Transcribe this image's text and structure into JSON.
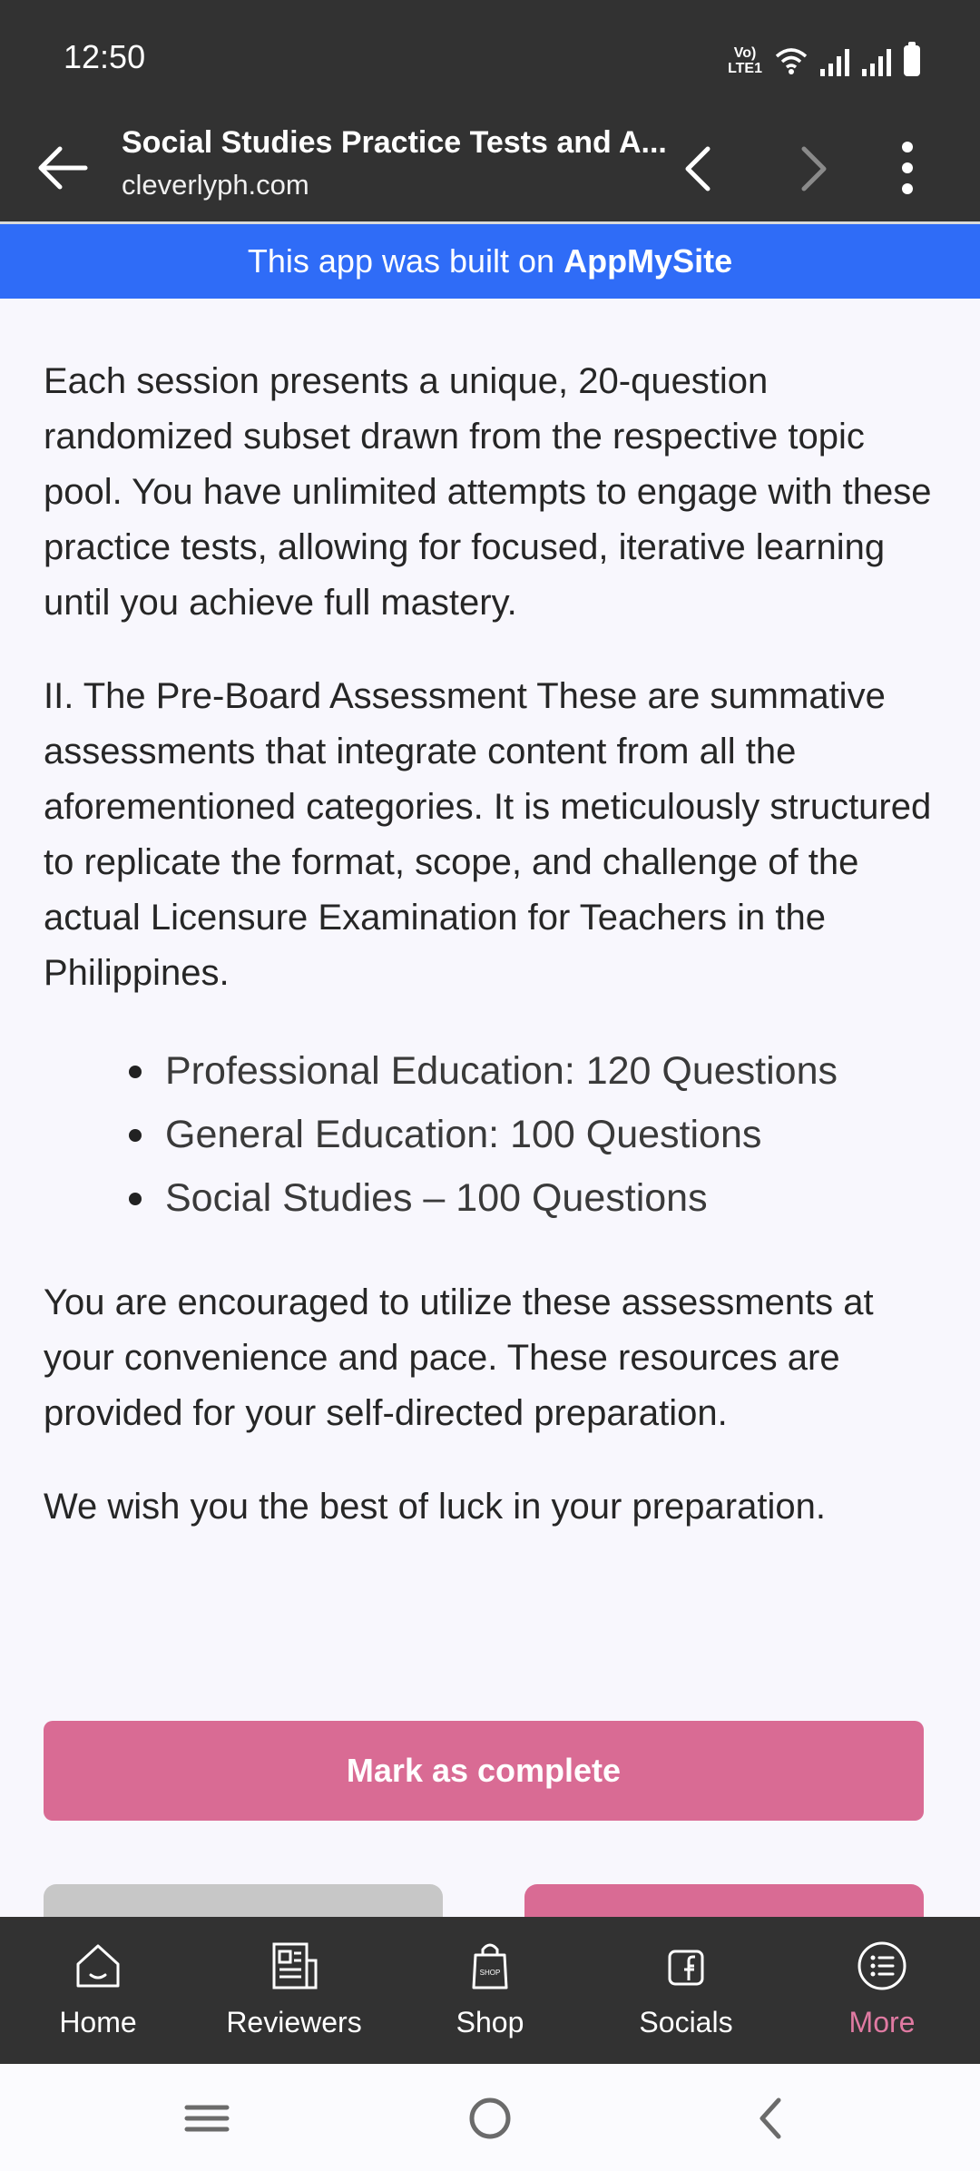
{
  "status_bar": {
    "time": "12:50",
    "network_label": "VoLTE",
    "lte_label": "LTE1"
  },
  "browser": {
    "title": "Social Studies Practice Tests and A...",
    "domain": "cleverlyph.com"
  },
  "banner": {
    "prefix": "This app was built on",
    "brand": "AppMySite"
  },
  "content": {
    "paragraph_1": "Each session presents a unique, 20-question randomized subset drawn from the respective topic pool. You have unlimited attempts to engage with these practice tests, allowing for focused, iterative learning until you achieve full mastery.",
    "paragraph_2": "II. The Pre-Board Assessment These are summative assessments that integrate content from all the aforementioned categories. It is meticulously structured to replicate the format, scope, and challenge of the actual Licensure Examination for Teachers in the Philippines.",
    "bullets": [
      "Professional Education: 120 Questions",
      "General Education: 100 Questions",
      "Social Studies – 100 Questions"
    ],
    "paragraph_3": "You are encouraged to utilize these assessments at your convenience and pace. These resources are provided for your self-directed preparation.",
    "paragraph_4": "We wish you the best of luck in your preparation."
  },
  "mark_complete_label": "Mark as complete",
  "bottom_nav": [
    {
      "label": "Home",
      "icon": "home-icon"
    },
    {
      "label": "Reviewers",
      "icon": "newspaper-icon"
    },
    {
      "label": "Shop",
      "icon": "shopping-bag-icon"
    },
    {
      "label": "Socials",
      "icon": "facebook-icon"
    },
    {
      "label": "More",
      "icon": "list-icon",
      "active": true
    }
  ],
  "colors": {
    "accent_pink": "#d96b94",
    "banner_blue": "#2f6cf7",
    "dark_bar": "#323232",
    "active_nav": "#e07aa2"
  }
}
